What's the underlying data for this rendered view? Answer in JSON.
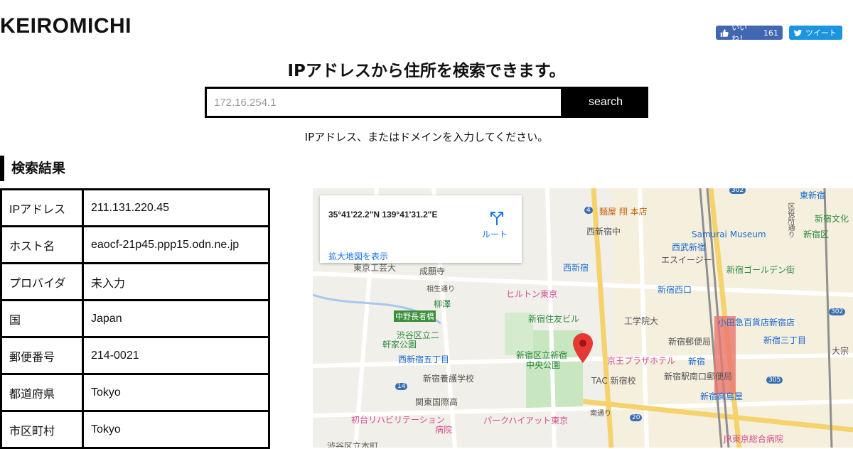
{
  "header": {
    "logo": "KEIROMICHI",
    "fb_label": "いいね！",
    "fb_count": "161",
    "tw_label": "ツイート"
  },
  "search": {
    "headline": "IPアドレスから住所を検索できます。",
    "placeholder": "172.16.254.1",
    "button_label": "search",
    "hint": "IPアドレス、またはドメインを入力してください。"
  },
  "results": {
    "title": "検索結果",
    "rows": [
      {
        "key": "IPアドレス",
        "value": "211.131.220.45"
      },
      {
        "key": "ホスト名",
        "value": "eaocf-21p45.ppp15.odn.ne.jp"
      },
      {
        "key": "プロバイダ",
        "value": "未入力"
      },
      {
        "key": "国",
        "value": "Japan"
      },
      {
        "key": "郵便番号",
        "value": "214-0021"
      },
      {
        "key": "都道府県",
        "value": "Tokyo"
      },
      {
        "key": "市区町村",
        "value": "Tokyo"
      }
    ]
  },
  "map": {
    "coordinates": "35°41'22.2\"N 139°41'31.2\"E",
    "route_label": "ルート",
    "large_map_link": "拡大地図を表示",
    "labels": {
      "menya": "麺屋 翔 本店",
      "nishishinjuku_naka": "西新宿中",
      "samurai": "Samurai Museum",
      "seibu": "西武新宿",
      "nishishinjuku_st": "西新宿",
      "esuiji": "エスイージー",
      "golden": "新宿ゴールデン街",
      "nishiguchi": "新宿西口",
      "higashishinjuku": "東新宿",
      "bunka": "新宿文化",
      "koku": "新宿区",
      "jokai": "東京工芸大",
      "seiganji": "成願寺",
      "aioi": "相生通り",
      "yanagi": "柳澤",
      "nakano": "中野長者橋",
      "hilton": "ヒルトン東京",
      "sumitomo": "新宿住友ビル",
      "kogakuin": "工学院大",
      "odakyu": "小田急百貨店新宿店",
      "sanchome": "新宿三丁目",
      "shibuya_school": "渋谷区立二",
      "kenka": "軒家公園",
      "nishishinjuku5": "西新宿五丁目",
      "chuo_park1": "新宿区立新宿",
      "chuo_park2": "中央公園",
      "keio": "京王プラザホテル",
      "post": "新宿郵便局",
      "shinjuku": "新宿",
      "yogo": "新宿養護学校",
      "tac": "TAC 新宿校",
      "minamiguchi": "新宿駅南口郵便局",
      "takashimaya": "新宿高島屋",
      "kanto": "関東国際高",
      "hatsudai1": "初台リハビリテーション",
      "hatsudai2": "病院",
      "hyatt": "パークハイアット東京",
      "minami_st": "南通り",
      "jr_hospital": "JR東京総合病院",
      "shibuya_kihon": "渋谷区立本町",
      "taisho": "大宗",
      "road_302a": "302",
      "road_302b": "302",
      "road_14": "14",
      "road_20": "20",
      "road_305": "305",
      "road_4": "4",
      "ward_road": "区役所通り"
    }
  }
}
